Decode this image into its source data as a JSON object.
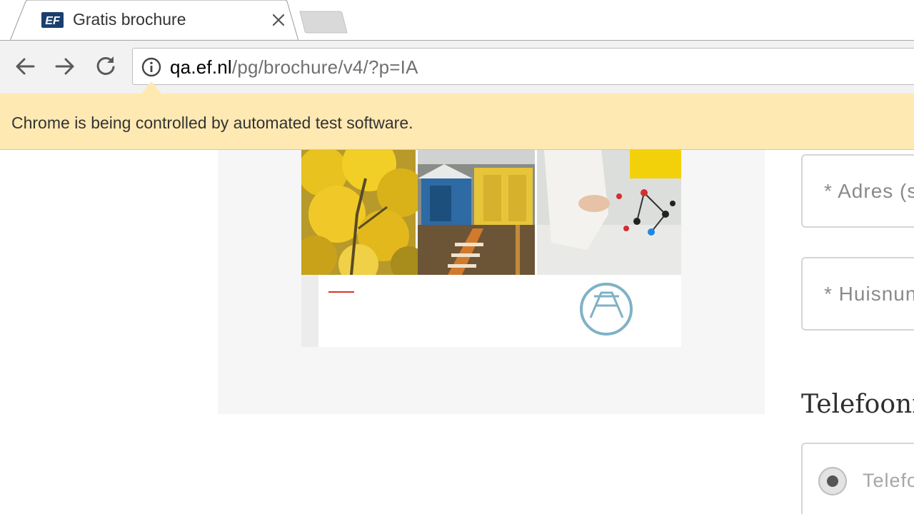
{
  "tab": {
    "title": "Gratis brochure",
    "favicon": "ef-logo-icon",
    "close_icon": "close-icon"
  },
  "toolbar": {
    "back_icon": "arrow-back-icon",
    "forward_icon": "arrow-forward-icon",
    "reload_icon": "reload-icon",
    "info_icon": "info-icon",
    "url_host": "qa.ef.nl",
    "url_path": "/pg/brochure/v4/?p=IA"
  },
  "infobar": {
    "message": "Chrome is being controlled by automated test software.",
    "color": "#ffe9b3"
  },
  "form": {
    "address_placeholder": "* Adres (s",
    "housenumber_placeholder": "* Huisnun",
    "phone_section_title": "Telefoonn",
    "phone_option_label": "Telefoo"
  }
}
